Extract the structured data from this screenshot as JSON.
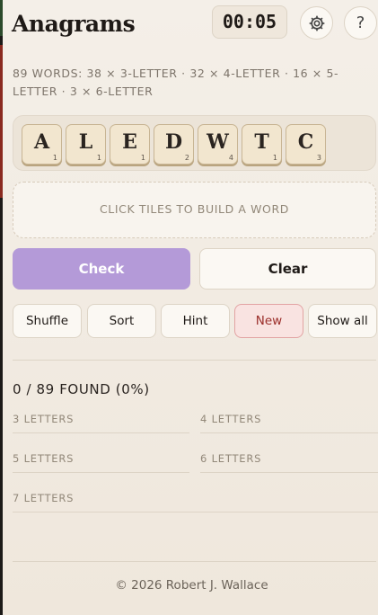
{
  "header": {
    "title": "Anagrams",
    "timer": "00:05",
    "settings_icon": "gear-icon",
    "help_label": "?"
  },
  "counts_text": "89 WORDS: 38 × 3-LETTER · 32 × 4-LETTER · 16 × 5-LETTER · 3 × 6-LETTER",
  "tiles": [
    {
      "letter": "A",
      "points": "1"
    },
    {
      "letter": "L",
      "points": "1"
    },
    {
      "letter": "E",
      "points": "1"
    },
    {
      "letter": "D",
      "points": "2"
    },
    {
      "letter": "W",
      "points": "4"
    },
    {
      "letter": "T",
      "points": "1"
    },
    {
      "letter": "C",
      "points": "3"
    }
  ],
  "dropzone_text": "CLICK TILES TO BUILD A WORD",
  "actions": {
    "check": "Check",
    "clear": "Clear",
    "shuffle": "Shuffle",
    "sort": "Sort",
    "hint": "Hint",
    "new": "New",
    "show_all": "Show all"
  },
  "found_text": "0 / 89 FOUND (0%)",
  "groups": [
    {
      "label": "3 LETTERS"
    },
    {
      "label": "4 LETTERS"
    },
    {
      "label": "5 LETTERS"
    },
    {
      "label": "6 LETTERS"
    },
    {
      "label": "7 LETTERS"
    }
  ],
  "footer": "© 2026 Robert J. Wallace",
  "colors": {
    "background": "#f3eee6",
    "check_button": "#b49ad8",
    "new_button_text": "#9b2e2a",
    "new_button_bg": "#f9e3e1",
    "tile": "#f2e6cf"
  }
}
